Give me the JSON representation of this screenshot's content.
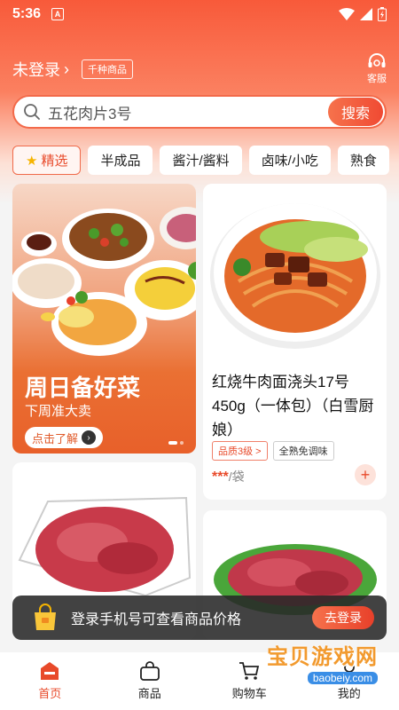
{
  "status_bar": {
    "time": "5:36",
    "notification_badge": "A"
  },
  "header": {
    "login_label": "未登录",
    "tag": "千种商品",
    "service_label": "客服"
  },
  "search": {
    "query": "五花肉片3号",
    "button_label": "搜索"
  },
  "categories": [
    {
      "label": "精选",
      "active": true
    },
    {
      "label": "半成品"
    },
    {
      "label": "酱汁/酱料"
    },
    {
      "label": "卤味/小吃"
    },
    {
      "label": "熟食"
    }
  ],
  "banner": {
    "title": "周日备好菜",
    "subtitle": "下周准大卖",
    "button_label": "点击了解"
  },
  "product": {
    "title": "红烧牛肉面浇头17号450g（一体包）（白雪厨娘）",
    "badge_quality": "品质3级 >",
    "badge_tag": "全熟免调味",
    "price_masked": "***",
    "unit": "/袋"
  },
  "login_prompt": {
    "text": "登录手机号可查看商品价格",
    "button_label": "去登录"
  },
  "bottom_nav": [
    {
      "label": "首页",
      "icon": "home-icon",
      "active": true
    },
    {
      "label": "商品",
      "icon": "bag-icon"
    },
    {
      "label": "购物车",
      "icon": "cart-icon"
    },
    {
      "label": "我的",
      "icon": "user-icon"
    }
  ],
  "watermark": {
    "text": "宝贝游戏网",
    "url": "baobeiy.com"
  },
  "colors": {
    "accent": "#e84a2a",
    "header_gradient_top": "#f85a3a"
  }
}
